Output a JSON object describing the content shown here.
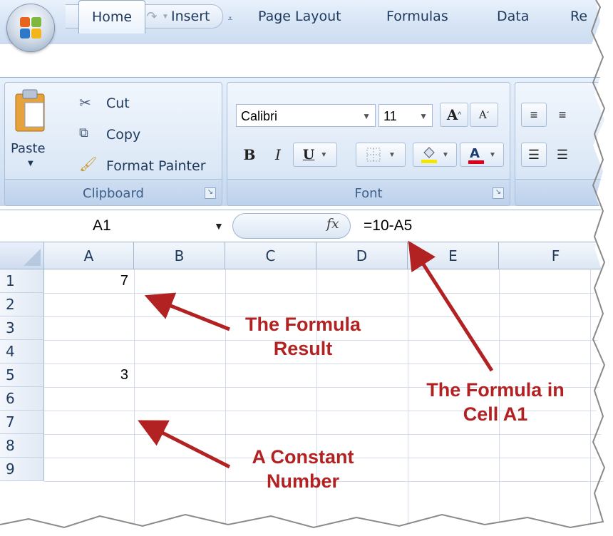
{
  "qat": {
    "icons": [
      "office-button-icon",
      "save-icon",
      "undo-icon",
      "redo-icon",
      "customize-icon"
    ]
  },
  "tabs": [
    "Home",
    "Insert",
    "Page Layout",
    "Formulas",
    "Data",
    "Re"
  ],
  "clipboard": {
    "paste_label": "Paste",
    "cut_label": "Cut",
    "copy_label": "Copy",
    "format_painter_label": "Format Painter",
    "group_label": "Clipboard"
  },
  "font": {
    "name": "Calibri",
    "size": "11",
    "group_label": "Font",
    "bold": "B",
    "italic": "I",
    "underline": "U",
    "grow": "A",
    "shrink": "A"
  },
  "formula_bar": {
    "name_box": "A1",
    "fx": "fx",
    "content": "=10-A5"
  },
  "columns": [
    "A",
    "B",
    "C",
    "D",
    "E",
    "F"
  ],
  "rows": [
    "1",
    "2",
    "3",
    "4",
    "5",
    "6",
    "7",
    "8",
    "9"
  ],
  "cells": {
    "A1": "7",
    "A5": "3"
  },
  "annotations": {
    "result": [
      "The Formula",
      "Result"
    ],
    "formula": [
      "The Formula in",
      "Cell A1"
    ],
    "constant": [
      "A Constant",
      "Number"
    ]
  },
  "colors": {
    "annotation": "#b22222",
    "ribbon": "#d6e4f5"
  }
}
